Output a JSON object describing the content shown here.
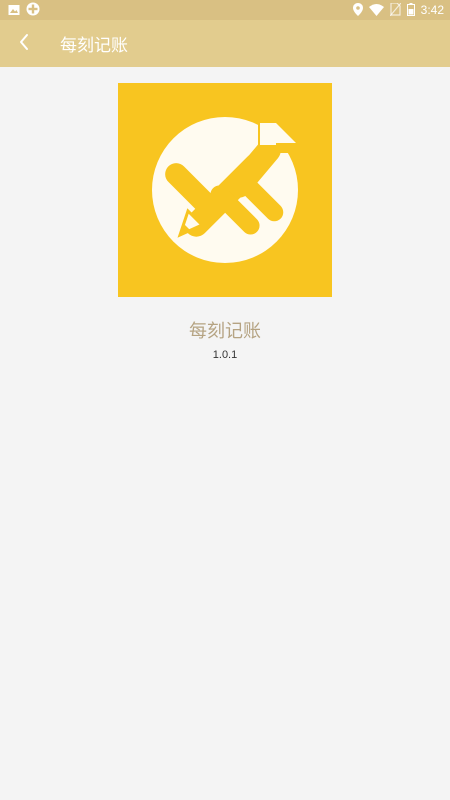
{
  "status_bar": {
    "time": "3:42",
    "icons": [
      "image-icon",
      "app-notification-icon",
      "location-icon",
      "wifi-icon",
      "no-sim-icon",
      "battery-icon"
    ]
  },
  "header": {
    "title": "每刻记账",
    "back_icon": "chevron-left-icon"
  },
  "about": {
    "app_name": "每刻记账",
    "version": "1.0.1",
    "logo_icon": "pencil-yen-logo"
  },
  "colors": {
    "status_bar": "#d9c083",
    "app_bar": "#e2cc8e",
    "logo_bg": "#f8c520",
    "app_name_text": "#b5a382",
    "background": "#f4f4f4"
  }
}
